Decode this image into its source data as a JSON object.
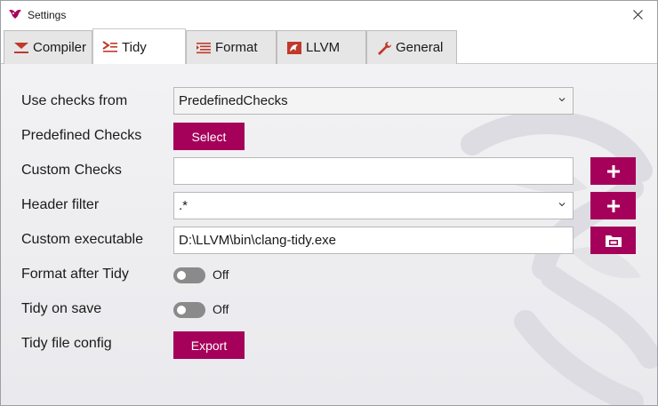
{
  "window": {
    "title": "Settings"
  },
  "tabs": [
    {
      "label": "Compiler",
      "icon": "compiler-icon"
    },
    {
      "label": "Tidy",
      "icon": "tidy-icon"
    },
    {
      "label": "Format",
      "icon": "format-icon"
    },
    {
      "label": "LLVM",
      "icon": "llvm-icon"
    },
    {
      "label": "General",
      "icon": "wrench-icon"
    }
  ],
  "active_tab": "Tidy",
  "form": {
    "use_checks_from": {
      "label": "Use checks from",
      "value": "PredefinedChecks"
    },
    "predefined_checks": {
      "label": "Predefined Checks",
      "button": "Select"
    },
    "custom_checks": {
      "label": "Custom Checks",
      "value": ""
    },
    "header_filter": {
      "label": "Header filter",
      "value": ".*"
    },
    "custom_executable": {
      "label": "Custom executable",
      "value": "D:\\LLVM\\bin\\clang-tidy.exe"
    },
    "format_after_tidy": {
      "label": "Format after Tidy",
      "state": "Off"
    },
    "tidy_on_save": {
      "label": "Tidy on save",
      "state": "Off"
    },
    "tidy_file_config": {
      "label": "Tidy file config",
      "button": "Export"
    }
  },
  "colors": {
    "accent": "#a5005a",
    "toggle_off": "#8a8a8a"
  }
}
